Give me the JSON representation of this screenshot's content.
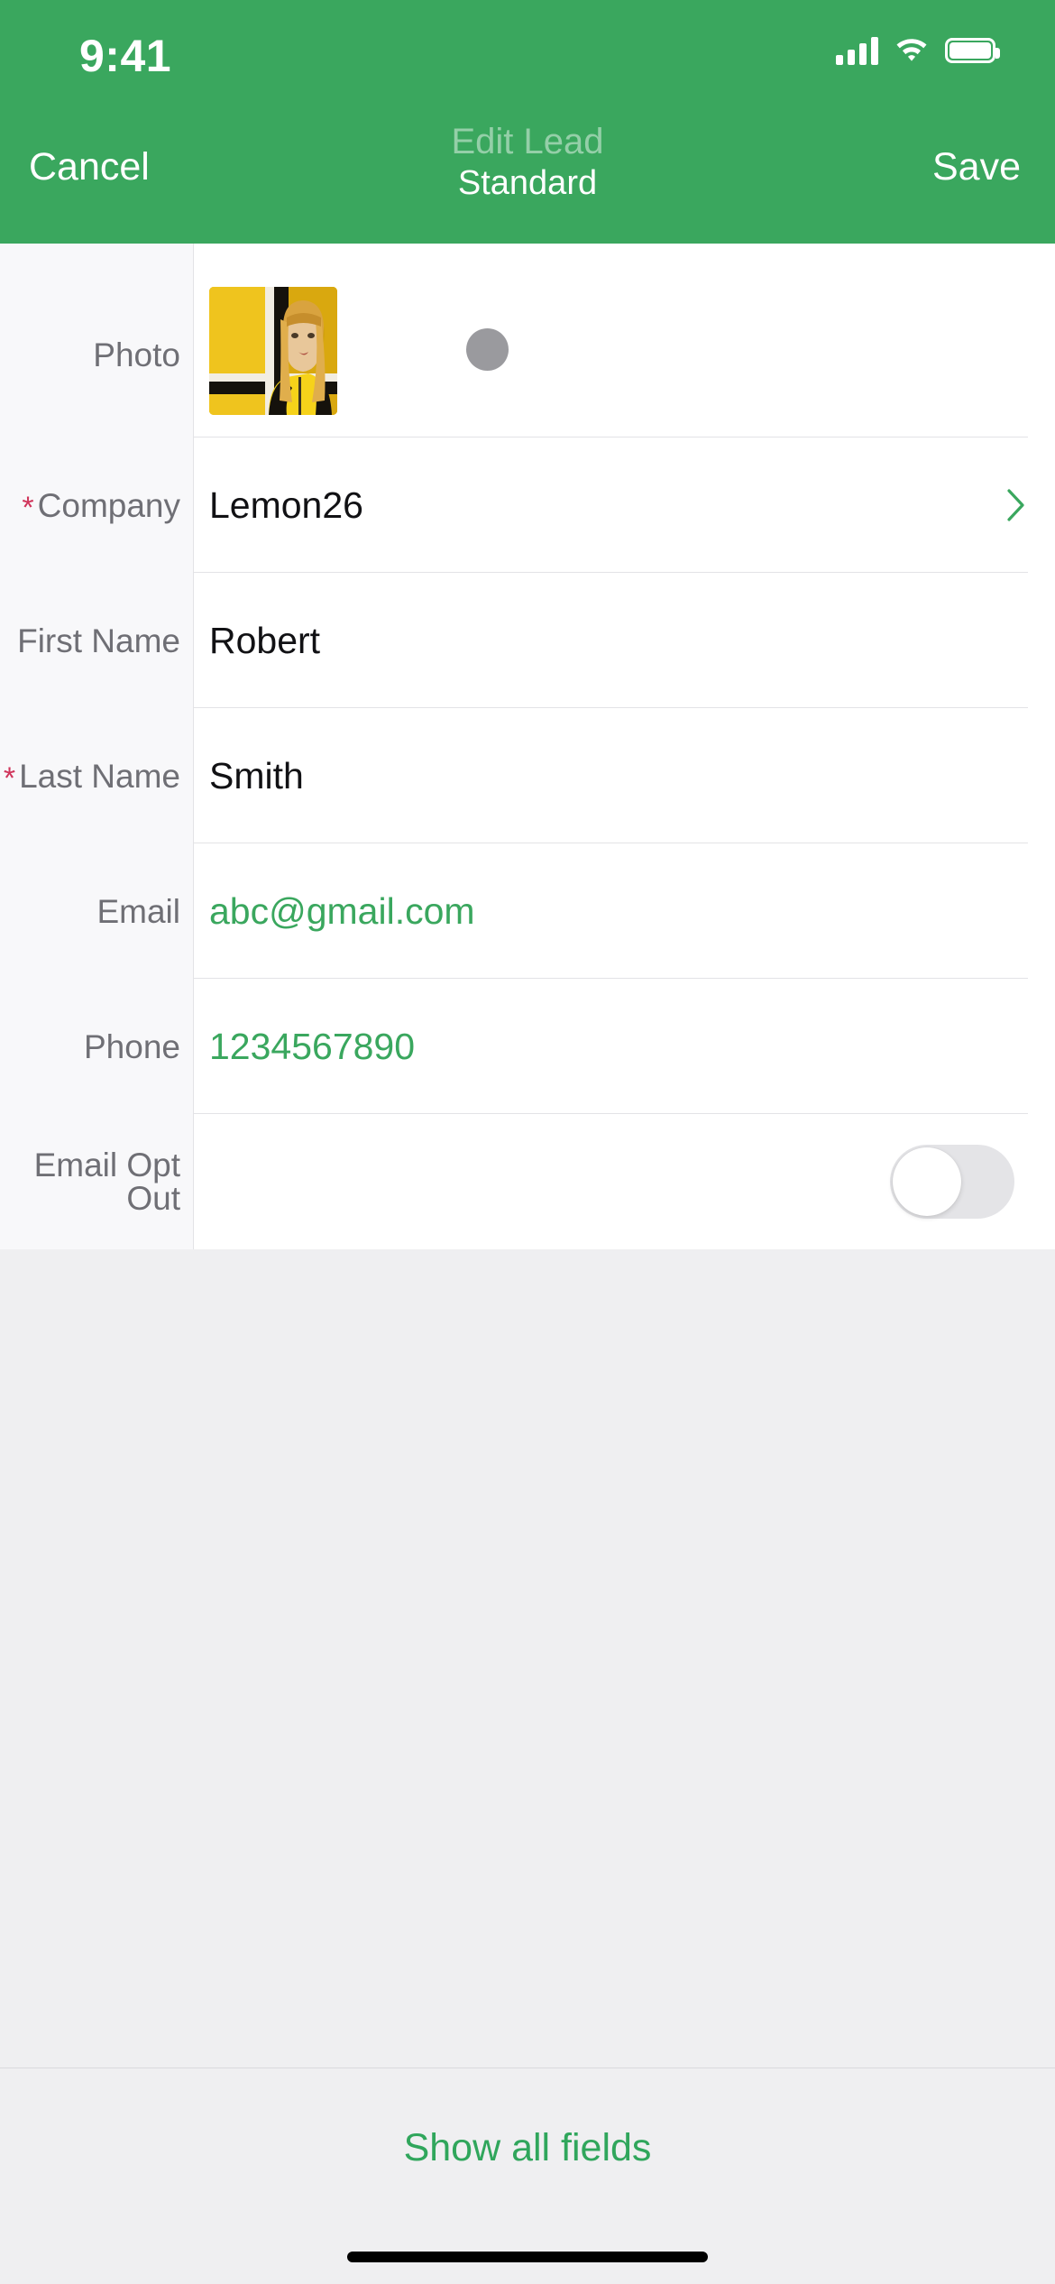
{
  "status_bar": {
    "time": "9:41",
    "signal_icon": "cellular-signal-icon",
    "wifi_icon": "wifi-icon",
    "battery_icon": "battery-full-icon"
  },
  "navbar": {
    "cancel_label": "Cancel",
    "save_label": "Save",
    "title": "Edit Lead",
    "subtitle": "Standard",
    "background_color": "#3AA75E",
    "title_color": "rgba(255,255,255,0.46)",
    "subtitle_color": "#FFFFFF"
  },
  "form": {
    "photo_row": {
      "label": "Photo",
      "thumbnail_alt": "portrait of blonde woman in yellow track jacket against yellow wall",
      "action_button": "photo-action-circle"
    },
    "fields": [
      {
        "label": "Company",
        "required": true,
        "value": "Lemon26",
        "value_color": "#111114",
        "has_chevron": true,
        "link": false
      },
      {
        "label": "First Name",
        "required": false,
        "value": "Robert",
        "value_color": "#111114",
        "has_chevron": false,
        "link": false
      },
      {
        "label": "Last Name",
        "required": true,
        "value": "Smith",
        "value_color": "#111114",
        "has_chevron": false,
        "link": false
      },
      {
        "label": "Email",
        "required": false,
        "value": "abc@gmail.com",
        "value_color": "#3AA75E",
        "has_chevron": false,
        "link": true
      },
      {
        "label": "Phone",
        "required": false,
        "value": "1234567890",
        "value_color": "#3AA75E",
        "has_chevron": false,
        "link": true
      }
    ],
    "toggle_row": {
      "label": "Email Opt Out",
      "state": "off"
    },
    "required_marker": "*",
    "required_marker_color": "#D0355B"
  },
  "footer": {
    "show_all_fields_label": "Show all fields",
    "link_color": "#30A65C"
  }
}
